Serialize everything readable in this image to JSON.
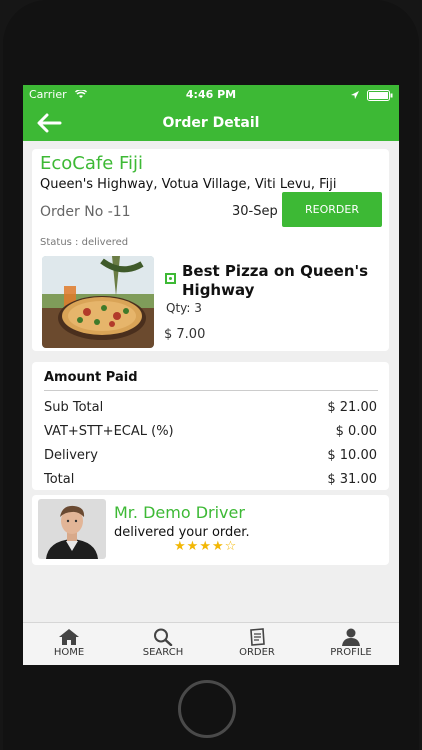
{
  "status_bar": {
    "carrier": "Carrier",
    "time": "4:46 PM"
  },
  "header": {
    "title": "Order Detail"
  },
  "order": {
    "cafe_name": "EcoCafe Fiji",
    "address": "Queen's Highway, Votua Village, Viti Levu, Fiji",
    "order_no": "Order No -11",
    "date": "30-Sep",
    "reorder_label": "REORDER",
    "status": "Status : delivered",
    "item": {
      "name": "Best Pizza on Queen's Highway",
      "qty": "Qty: 3",
      "price": "$ 7.00"
    }
  },
  "amount": {
    "title": "Amount Paid",
    "rows": [
      {
        "label": "Sub Total",
        "value": "$ 21.00"
      },
      {
        "label": "VAT+STT+ECAL (%)",
        "value": "$ 0.00"
      },
      {
        "label": "Delivery",
        "value": "$ 10.00"
      },
      {
        "label": "Total",
        "value": "$ 31.00"
      }
    ]
  },
  "driver": {
    "name": "Mr. Demo Driver",
    "message": "delivered your order.",
    "rating": 4,
    "rating_max": 5
  },
  "tabs": [
    {
      "label": "HOME",
      "icon": "home-icon"
    },
    {
      "label": "SEARCH",
      "icon": "search-icon"
    },
    {
      "label": "ORDER",
      "icon": "order-icon"
    },
    {
      "label": "PROFILE",
      "icon": "profile-icon"
    }
  ],
  "colors": {
    "accent": "#3db935",
    "star": "#f2b705"
  }
}
